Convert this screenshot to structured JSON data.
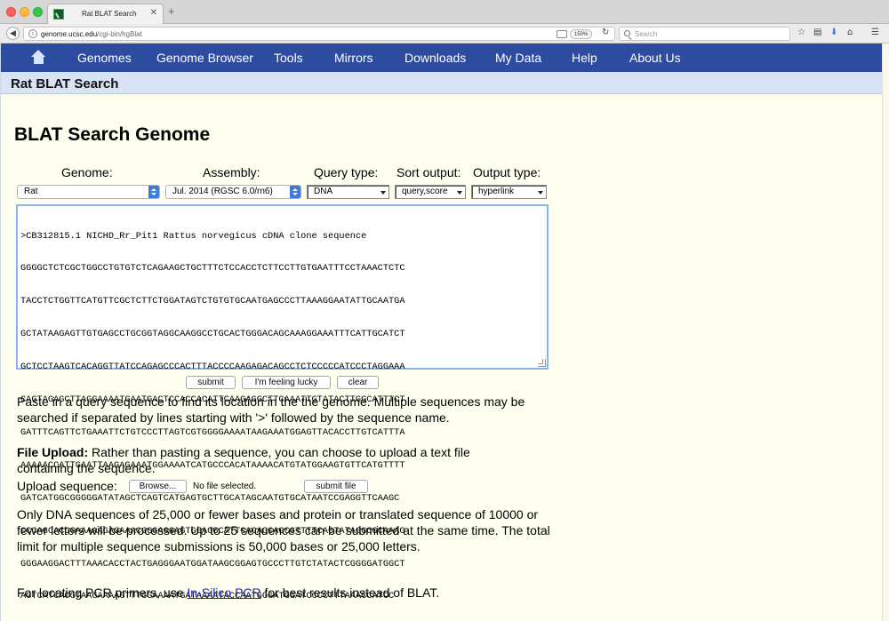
{
  "browser": {
    "tab_title": "Rat BLAT Search",
    "tab_close": "✕",
    "new_tab": "+",
    "url_host": "genome.ucsc.edu",
    "url_path": "/cgi-bin/hgBlat",
    "info_glyph": "i",
    "back_glyph": "◀",
    "zoom": "150%",
    "reload_glyph": "↻",
    "search_placeholder": "Search",
    "toolbar_icons": {
      "bookmark": "☆",
      "library": "▤",
      "download": "⬇",
      "home": "⌂",
      "menu": "☰"
    }
  },
  "nav": {
    "items": [
      {
        "label": "Genomes"
      },
      {
        "label": "Genome Browser"
      },
      {
        "label": "Tools"
      },
      {
        "label": "Mirrors"
      },
      {
        "label": "Downloads"
      },
      {
        "label": "My Data"
      },
      {
        "label": "Help"
      },
      {
        "label": "About Us"
      }
    ]
  },
  "page": {
    "band_title": "Rat BLAT Search",
    "heading": "BLAT Search Genome"
  },
  "form": {
    "labels": {
      "genome": "Genome:",
      "assembly": "Assembly:",
      "query_type": "Query type:",
      "sort_output": "Sort output:",
      "output_type": "Output type:"
    },
    "values": {
      "genome": "Rat",
      "assembly": "Jul. 2014 (RGSC 6.0/rn6)",
      "query_type": "DNA",
      "sort_output": "query,score",
      "output_type": "hyperlink"
    },
    "sequence": [
      ">CB312815.1 NICHD_Rr_Pit1 Rattus norvegicus cDNA clone sequence",
      "GGGGCTCTCGCTGGCCTGTGTCTCAGAAGCTGCTTTCTCCACCTCTTCCTTGTGAATTTCCTAAACTCTC",
      "TACCTCTGGTTCATGTTCGCTCTTCTGGATAGTCTGTGTGCAATGAGCCCTTAAAGGAATATTGCAATGA",
      "GCTATAAGAGTTGTGAGCCTGCGGTAGGCAAGGCCTGCACTGGGACAGCAAAGGAAATTTCATTGCATCT",
      "GCTCCTAAGTCACAGGTTATCCAGAGCCCACTTTACCCCAAGAGACAGCCTCTCCCCCATCCCTAGGAAA",
      "CAGTAGAGCTTAGGAAAATGAATGACTCCACCACATTCAAGAGGCTTCAAATTGTATACTTGGCATTTCT",
      "GATTTCAGTTCTGAAATTCTGTCCCTTAGTCGTGGGGAAAATAAGAAATGGAGTTACACCTTGTCATTTA",
      "AAAAACCATTGAATTAAGAGAAATGGAAAATCATGCCCACATAAAACATGTATGGAAGTGTTCATGTTTT",
      "GATCATGGCGGGGGATATAGCTCAGTCATGAGTGCTTGCATAGCAATGTGCATAATCCGAGGTTCAAGC",
      "CCCAGCACCGAAAAAGAGAAACGGGAGGAGTGGAGGCATTCACAGCAGCGTTTTCAGTATAGGCGCAAAG",
      "GGGAAGGACTTTAAACACCTACTGAGGGAATGGATAAGCGGAGTGCCCTTGTCTATACTCGGGGATGGCT",
      "AGTCATCACGTAAGAAAAGTTTGGAAAATGATAAAATACCAATGGGATGGATCCCCTTTAAACCATCC"
    ],
    "buttons": {
      "submit": "submit",
      "lucky": "I'm feeling lucky",
      "clear": "clear",
      "browse": "Browse...",
      "submit_file": "submit file"
    }
  },
  "text": {
    "paste_help": "Paste in a query sequence to find its location in the the genome. Multiple sequences may be searched if separated by lines starting with '>' followed by the sequence name.",
    "file_upload_bold": "File Upload:",
    "file_upload_rest": " Rather than pasting a sequence, you can choose to upload a text file containing the sequence.",
    "upload_label": "Upload sequence:",
    "no_file": "No file selected.",
    "limits": "Only DNA sequences of 25,000 or fewer bases and protein or translated sequence of 10000 or fewer letters will be processed. Up to 25 sequences can be submitted at the same time. The total limit for multiple sequence submissions is 50,000 bases or 25,000 letters.",
    "pcr_before": "For locating PCR primers, use ",
    "pcr_link": "In-Silico PCR",
    "pcr_after": " for best results instead of BLAT."
  },
  "colors": {
    "nav_bg": "#2e4c9f",
    "band_bg": "#d9e3f6",
    "page_bg": "#ffffef",
    "link": "#1a23b3"
  }
}
